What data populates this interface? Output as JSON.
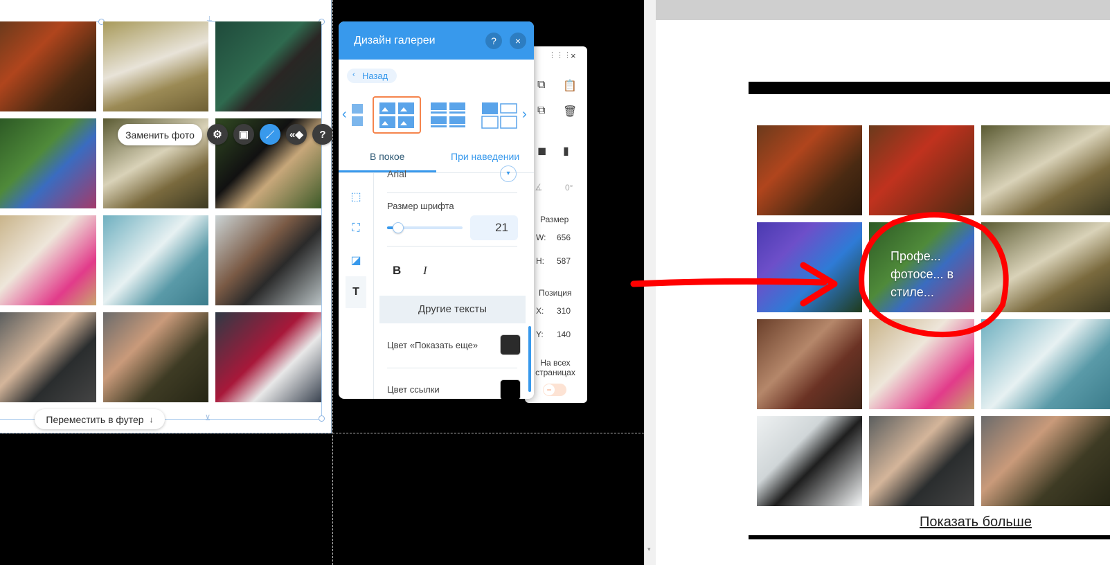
{
  "editor": {
    "replace_photo_label": "Заменить фото",
    "move_to_footer_label": "Переместить в футер",
    "toolbar_icons": [
      "gear-icon",
      "layout-icon",
      "brush-icon",
      "animation-icon",
      "help-icon"
    ]
  },
  "design_panel": {
    "title": "Дизайн галереи",
    "help_label": "?",
    "close_label": "×",
    "back_label": "Назад",
    "tabs": [
      "В покое",
      "При наведении"
    ],
    "font_value": "Arial",
    "font_size_label": "Размер шрифта",
    "font_size_value": "21",
    "font_size_fraction": 0.14,
    "bold_label": "B",
    "italic_label": "I",
    "other_texts_label": "Другие тексты",
    "show_more_color_label": "Цвет «Показать еще»",
    "link_color_label": "Цвет ссылки",
    "swatch_colors": [
      "#2b2b2b",
      "#000000"
    ],
    "accent": "#3899ec"
  },
  "props_panel": {
    "angle_value": "0°",
    "size_label": "Размер",
    "w_label": "W:",
    "w_value": "656",
    "h_label": "H:",
    "h_value": "587",
    "position_label": "Позиция",
    "x_label": "X:",
    "x_value": "310",
    "y_label": "Y:",
    "y_value": "140",
    "all_pages_label": "На всех страницах",
    "close_label": "×"
  },
  "preview": {
    "hover_text": "Профе... фотосе... в стиле...",
    "show_more_label": "Показать больше",
    "annotation_color": "#ff0000"
  }
}
